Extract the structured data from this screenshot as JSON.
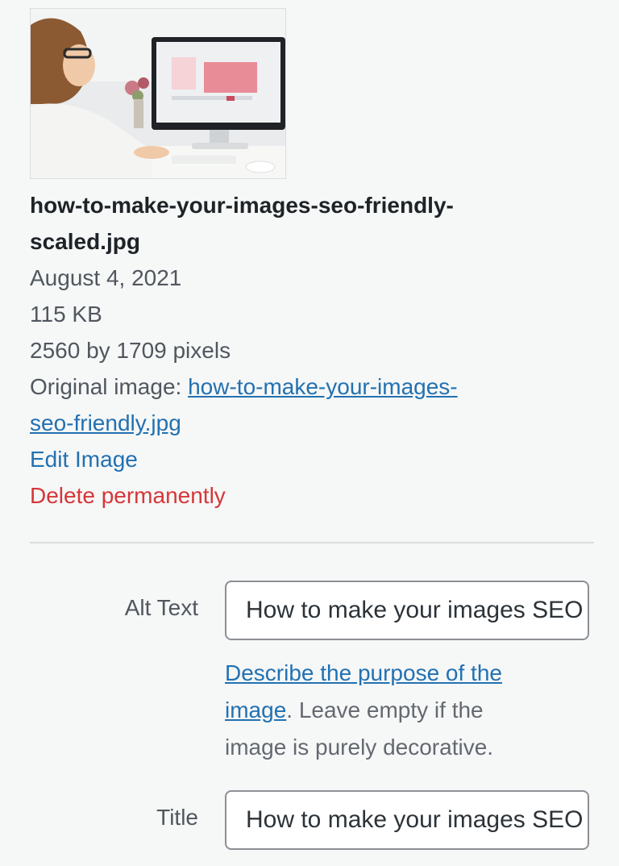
{
  "attachment": {
    "thumbnail_alt": "how-to-make-your-images-seo-friendly-scaled.jpg",
    "filename": "how-to-make-your-images-seo-friendly-scaled.jpg",
    "filename_line1": "how-to-make-your-images-seo-friendly-",
    "filename_line2": "scaled.jpg",
    "uploaded": "August 4, 2021",
    "file_size": "115 KB",
    "dimensions": "2560 by 1709 pixels",
    "original_label": "Original image: ",
    "original_link_line1": "how-to-make-your-images-",
    "original_link_line2": "seo-friendly.jpg",
    "edit_label": "Edit Image",
    "delete_label": "Delete permanently"
  },
  "fields": {
    "alt": {
      "label": "Alt Text",
      "value": "How to make your images SEO friendly"
    },
    "alt_help": {
      "link_line1": "Describe the purpose of the",
      "link_line2": "image",
      "text_after": ". Leave empty if the",
      "text_line3": "image is purely decorative."
    },
    "title": {
      "label": "Title",
      "value": "How to make your images SEO friendly"
    }
  },
  "colors": {
    "link": "#2271b1",
    "delete": "#d63638",
    "background": "#f6f7f7"
  }
}
